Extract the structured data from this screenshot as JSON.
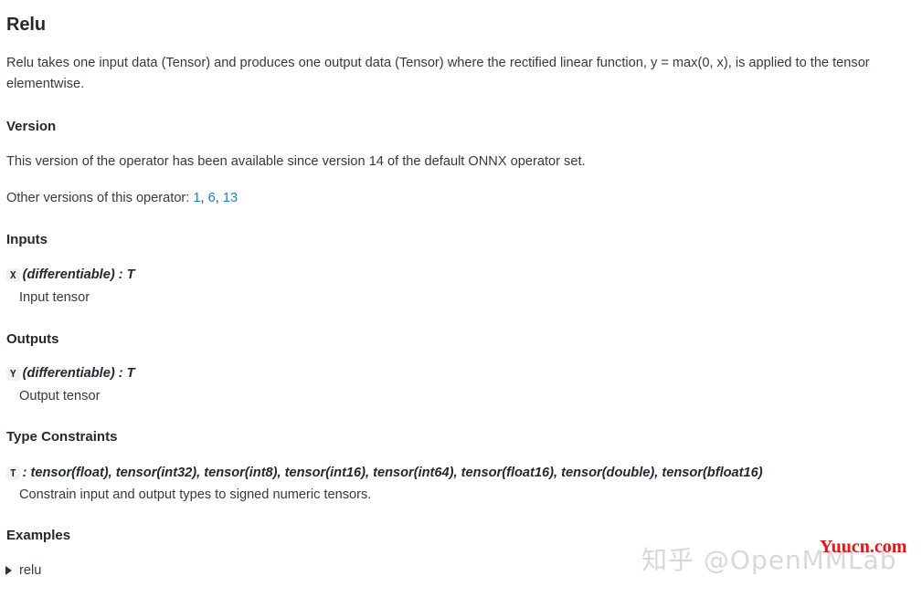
{
  "page": {
    "title": "Relu",
    "description": "Relu takes one input data (Tensor) and produces one output data (Tensor) where the rectified linear function, y = max(0, x), is applied to the tensor elementwise."
  },
  "version": {
    "heading": "Version",
    "text": "This version of the operator has been available since version 14 of the default ONNX operator set.",
    "other_versions_label": "Other versions of this operator: ",
    "other_versions": [
      {
        "label": "1",
        "separator": ", "
      },
      {
        "label": "6",
        "separator": ", "
      },
      {
        "label": "13",
        "separator": ""
      }
    ]
  },
  "inputs": {
    "heading": "Inputs",
    "items": [
      {
        "name": "X",
        "signature": "(differentiable) : T",
        "description": "Input tensor"
      }
    ]
  },
  "outputs": {
    "heading": "Outputs",
    "items": [
      {
        "name": "Y",
        "signature": "(differentiable) : T",
        "description": "Output tensor"
      }
    ]
  },
  "type_constraints": {
    "heading": "Type Constraints",
    "items": [
      {
        "name": "T",
        "signature": ": tensor(float), tensor(int32), tensor(int8), tensor(int16), tensor(int64), tensor(float16), tensor(double), tensor(bfloat16)",
        "description": "Constrain input and output types to signed numeric tensors."
      }
    ]
  },
  "examples": {
    "heading": "Examples",
    "items": [
      {
        "label": "relu",
        "expanded": false
      }
    ]
  },
  "watermarks": {
    "zhihu": "知乎 @OpenMMLab",
    "site": "Yuucn.com"
  },
  "colors": {
    "link": "#1a7fd4",
    "text": "#343a40",
    "heading": "#24292f",
    "badge_bg": "#f0f1f3",
    "watermark_zhihu": "#d8d8d8",
    "watermark_site": "#ee1111"
  }
}
